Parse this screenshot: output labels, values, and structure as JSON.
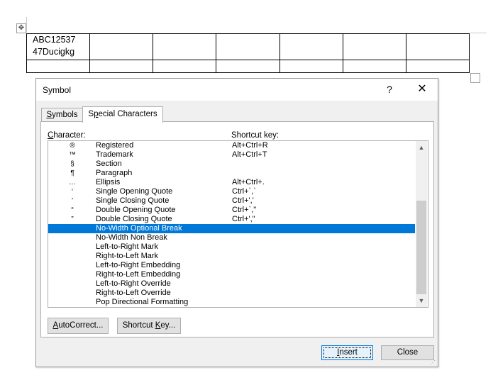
{
  "document": {
    "table": {
      "rows": [
        [
          "ABC12537\n47Ducigkg",
          "",
          "",
          "",
          "",
          "",
          ""
        ],
        [
          "",
          "",
          "",
          "",
          "",
          "",
          ""
        ]
      ]
    }
  },
  "dialog": {
    "title": "Symbol",
    "help": "?",
    "close_glyph": "✕",
    "tabs": [
      {
        "label_pre": "",
        "label_u": "S",
        "label_post": "ymbols",
        "active": false
      },
      {
        "label_pre": "S",
        "label_u": "p",
        "label_post": "ecial Characters",
        "active": true
      }
    ],
    "headers": {
      "character_u": "C",
      "character_rest": "haracter:",
      "shortcut": "Shortcut key:"
    },
    "rows": [
      {
        "glyph": "®",
        "name": "Registered",
        "key": "Alt+Ctrl+R"
      },
      {
        "glyph": "™",
        "name": "Trademark",
        "key": "Alt+Ctrl+T"
      },
      {
        "glyph": "§",
        "name": "Section",
        "key": ""
      },
      {
        "glyph": "¶",
        "name": "Paragraph",
        "key": ""
      },
      {
        "glyph": "…",
        "name": "Ellipsis",
        "key": "Alt+Ctrl+."
      },
      {
        "glyph": "‘",
        "name": "Single Opening Quote",
        "key": "Ctrl+`,`"
      },
      {
        "glyph": "’",
        "name": "Single Closing Quote",
        "key": "Ctrl+','"
      },
      {
        "glyph": "“",
        "name": "Double Opening Quote",
        "key": "Ctrl+`,\""
      },
      {
        "glyph": "”",
        "name": "Double Closing Quote",
        "key": "Ctrl+',\""
      },
      {
        "glyph": "",
        "name": "No-Width Optional Break",
        "key": "",
        "selected": true
      },
      {
        "glyph": "",
        "name": "No-Width Non Break",
        "key": ""
      },
      {
        "glyph": "",
        "name": "Left-to-Right Mark",
        "key": ""
      },
      {
        "glyph": "",
        "name": "Right-to-Left Mark",
        "key": ""
      },
      {
        "glyph": "",
        "name": "Left-to-Right Embedding",
        "key": ""
      },
      {
        "glyph": "",
        "name": "Right-to-Left Embedding",
        "key": ""
      },
      {
        "glyph": "",
        "name": "Left-to-Right Override",
        "key": ""
      },
      {
        "glyph": "",
        "name": "Right-to-Left Override",
        "key": ""
      },
      {
        "glyph": "",
        "name": "Pop Directional Formatting",
        "key": ""
      }
    ],
    "buttons": {
      "autocorrect_u": "A",
      "autocorrect_rest": "utoCorrect...",
      "shortcut_pre": "Shortcut ",
      "shortcut_u": "K",
      "shortcut_rest": "ey...",
      "insert_u": "I",
      "insert_rest": "nsert",
      "close": "Close"
    },
    "colors": {
      "selection": "#0078d7"
    }
  }
}
